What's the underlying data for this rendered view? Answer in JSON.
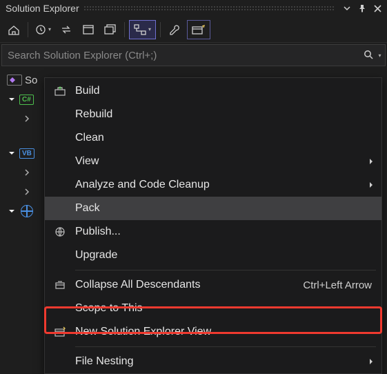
{
  "title": "Solution Explorer",
  "search": {
    "placeholder": "Search Solution Explorer (Ctrl+;)"
  },
  "tree": {
    "solution_label_visible": "So",
    "cs_badge": "C#",
    "vb_badge": "VB"
  },
  "menu": {
    "build": "Build",
    "rebuild": "Rebuild",
    "clean": "Clean",
    "view": "View",
    "analyze": "Analyze and Code Cleanup",
    "pack": "Pack",
    "publish": "Publish...",
    "upgrade": "Upgrade",
    "collapse": "Collapse All Descendants",
    "collapse_shortcut": "Ctrl+Left Arrow",
    "scope": "Scope to This",
    "newview": "New Solution Explorer View",
    "nesting": "File Nesting"
  }
}
